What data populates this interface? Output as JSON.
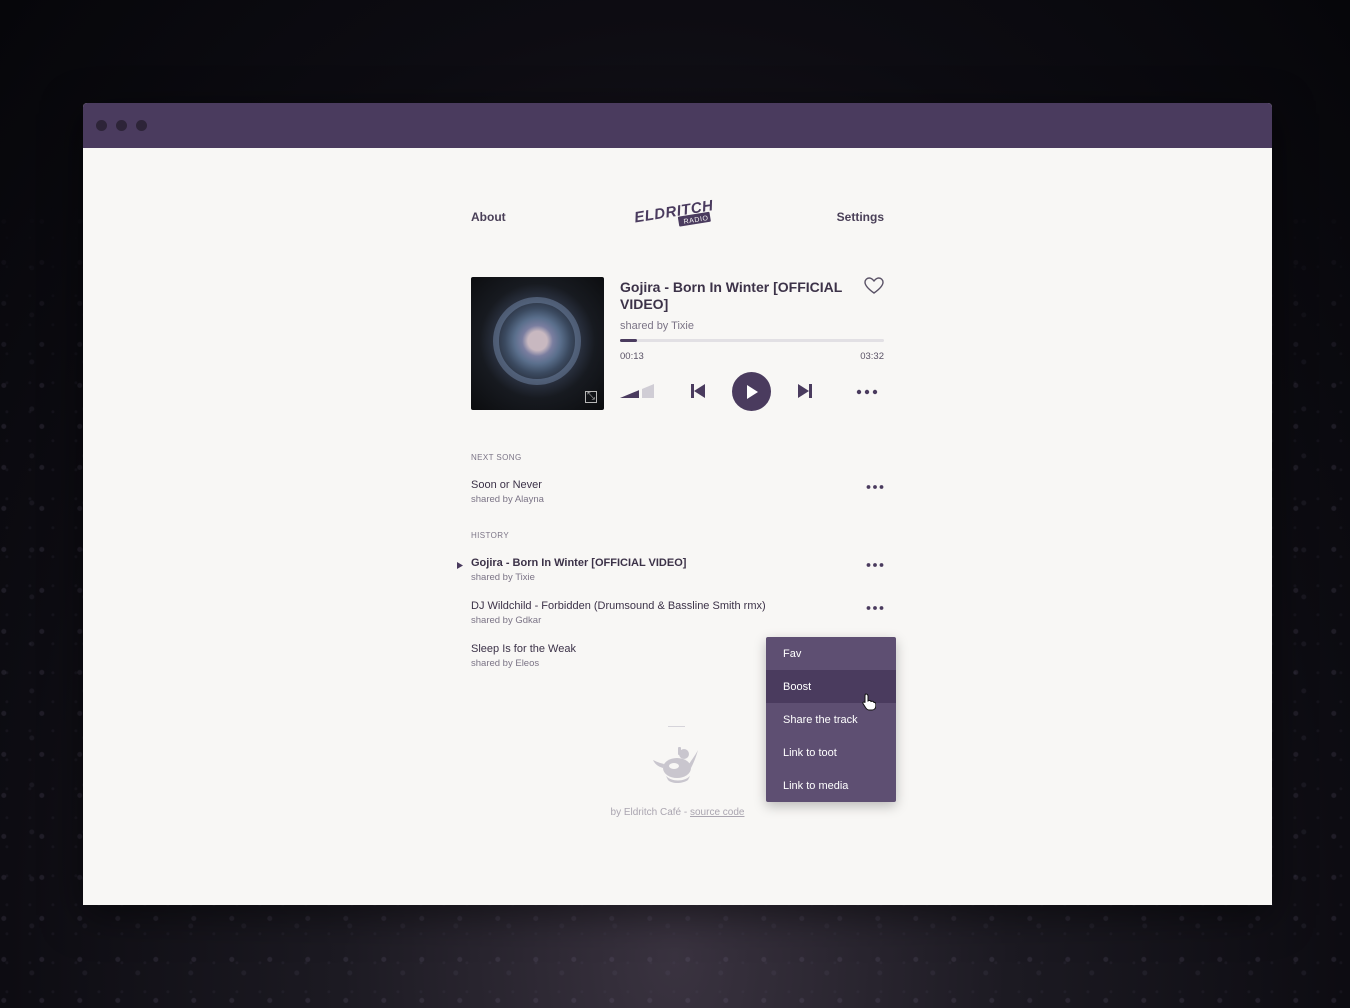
{
  "window": {
    "title": ""
  },
  "nav": {
    "about": "About",
    "settings": "Settings"
  },
  "logo": {
    "text_main": "ELDRITCH",
    "text_sub": "RADIO"
  },
  "now_playing": {
    "title": "Gojira - Born In Winter [OFFICIAL VIDEO]",
    "shared_by": "shared by Tixie",
    "time_current": "00:13",
    "time_total": "03:32",
    "progress": 0.066,
    "volume": 0.6
  },
  "next_song": {
    "label": "NEXT SONG",
    "title": "Soon or Never",
    "shared_by": "shared by Alayna"
  },
  "history": {
    "label": "HISTORY",
    "items": [
      {
        "title": "Gojira - Born In Winter [OFFICIAL VIDEO]",
        "shared_by": "shared by Tixie",
        "current": true
      },
      {
        "title": "DJ Wildchild - Forbidden (Drumsound & Bassline Smith rmx)",
        "shared_by": "shared by Gdkar",
        "current": false
      },
      {
        "title": "Sleep Is for the Weak",
        "shared_by": "shared by Eleos",
        "current": false
      }
    ]
  },
  "footer": {
    "text": "by Eldritch Café - ",
    "link": "source code"
  },
  "context_menu": {
    "items": [
      "Fav",
      "Boost",
      "Share the track",
      "Link to toot",
      "Link to media"
    ],
    "active_index": 1
  },
  "colors": {
    "accent": "#4a3b5e",
    "menu_bg": "#5e4f72",
    "page_bg": "#f8f7f5"
  },
  "icons": [
    "heart-icon",
    "volume-icon",
    "previous-icon",
    "play-icon",
    "next-icon",
    "more-icon",
    "expand-icon",
    "play-marker-icon",
    "mascot-icon",
    "pointer-cursor-icon"
  ]
}
